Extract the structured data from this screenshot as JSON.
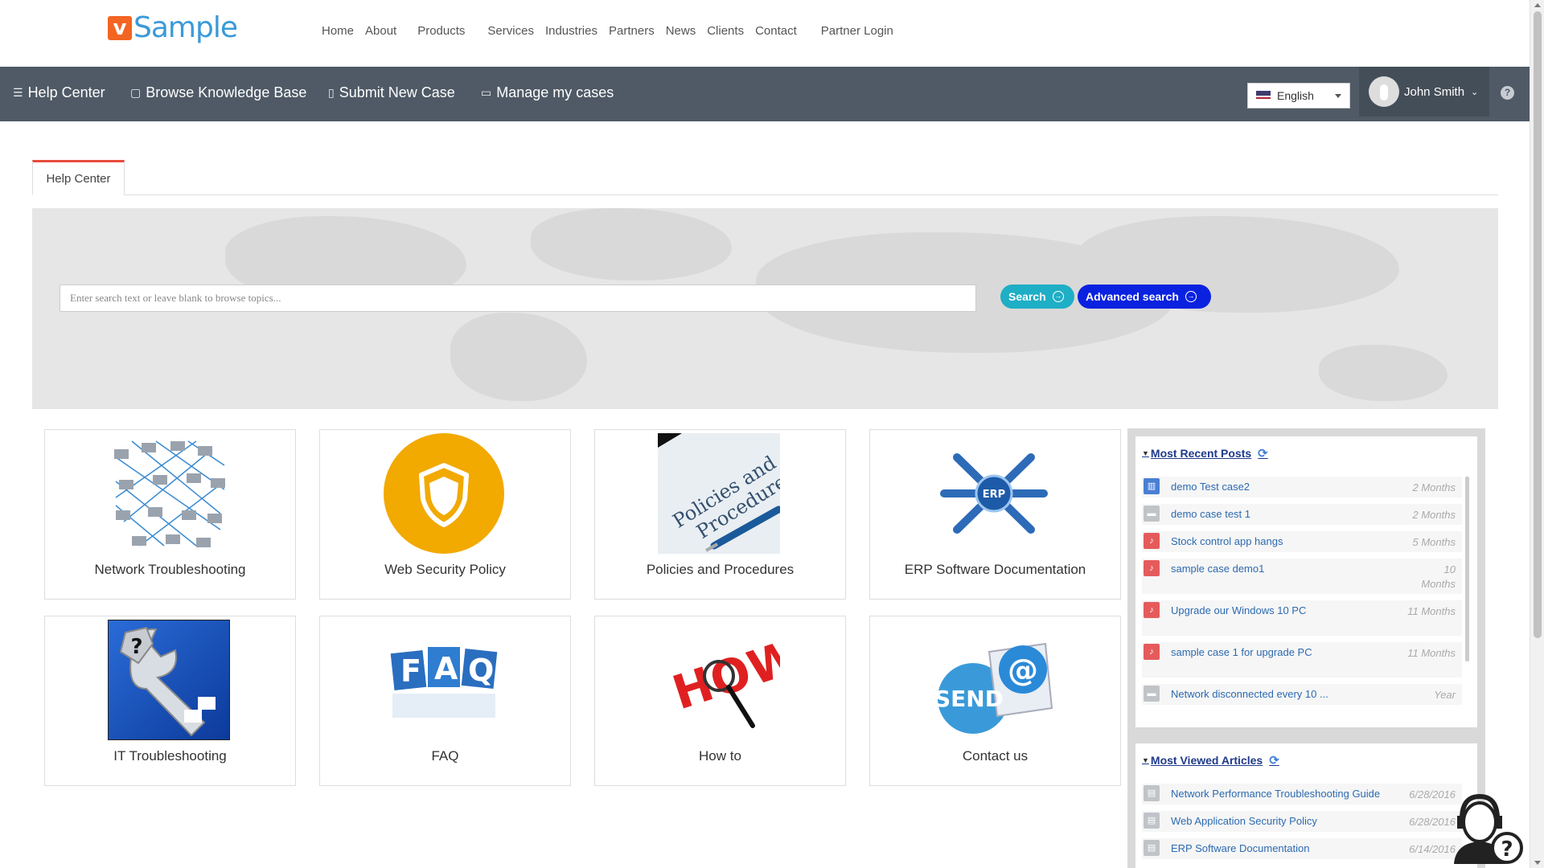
{
  "brand": {
    "logo_letter": "v",
    "logo_text": "Sample"
  },
  "topnav": [
    "Home",
    "About",
    "Products",
    "Services",
    "Industries",
    "Partners",
    "News",
    "Clients",
    "Contact",
    "Partner Login"
  ],
  "helpbar": {
    "help_center": "Help Center",
    "browse_kb": "Browse Knowledge Base",
    "submit_case": "Submit New Case",
    "manage_cases": "Manage my cases",
    "language": "English",
    "user_name": "John Smith"
  },
  "tab": {
    "label": "Help Center"
  },
  "search": {
    "placeholder": "Enter search text or leave blank to browse topics...",
    "search_label": "Search",
    "advanced_label": "Advanced search"
  },
  "categories": [
    {
      "label": "Network Troubleshooting",
      "icon": "network-icon"
    },
    {
      "label": "Web Security Policy",
      "icon": "shield-icon"
    },
    {
      "label": "Policies and Procedures",
      "icon": "document-pen-icon",
      "image_text": "Policies and Procedures"
    },
    {
      "label": "ERP Software Documentation",
      "icon": "erp-icon",
      "image_text": "ERP"
    },
    {
      "label": "IT Troubleshooting",
      "icon": "wrench-icon",
      "image_text": "?"
    },
    {
      "label": "FAQ",
      "icon": "faq-blocks-icon",
      "image_text": "FAQ"
    },
    {
      "label": "How to",
      "icon": "magnifier-icon",
      "image_text": "HOW"
    },
    {
      "label": "Contact us",
      "icon": "email-send-icon",
      "image_text": "SEND"
    }
  ],
  "recent_posts": {
    "title": "Most Recent Posts",
    "items": [
      {
        "title": "demo Test case2",
        "age": "2 Months",
        "kind": "chart",
        "color": "#4a7fd4"
      },
      {
        "title": "demo case test 1",
        "age": "2 Months",
        "kind": "briefcase",
        "color": "#c0c4c8"
      },
      {
        "title": "Stock control app hangs",
        "age": "5 Months",
        "kind": "bell",
        "color": "#e55b5b"
      },
      {
        "title": "sample case demo1",
        "age": "10 Months",
        "kind": "bell",
        "color": "#e55b5b"
      },
      {
        "title": "Upgrade our Windows 10 PC",
        "age": "11 Months",
        "kind": "bell",
        "color": "#e55b5b"
      },
      {
        "title": "sample case 1 for upgrade PC",
        "age": "11 Months",
        "kind": "bell",
        "color": "#e55b5b"
      },
      {
        "title": "Network disconnected every 10 ...",
        "age": "Year",
        "kind": "briefcase",
        "color": "#c0c4c8"
      }
    ]
  },
  "viewed_articles": {
    "title": "Most Viewed Articles",
    "items": [
      {
        "title": "Network Performance Troubleshooting Guide",
        "date": "6/28/2016"
      },
      {
        "title": "Web Application Security Policy",
        "date": "6/28/2016"
      },
      {
        "title": "ERP Software Documentation",
        "date": "6/14/2016"
      }
    ]
  },
  "support_widget": {
    "icon": "support-agent-icon",
    "badge": "?"
  },
  "colors": {
    "helpbar": "#4f5a66",
    "search_btn": "#1eaec5",
    "advanced_btn": "#0a22e0",
    "shield": "#f2a900",
    "accent_tab": "#e74c3c"
  }
}
